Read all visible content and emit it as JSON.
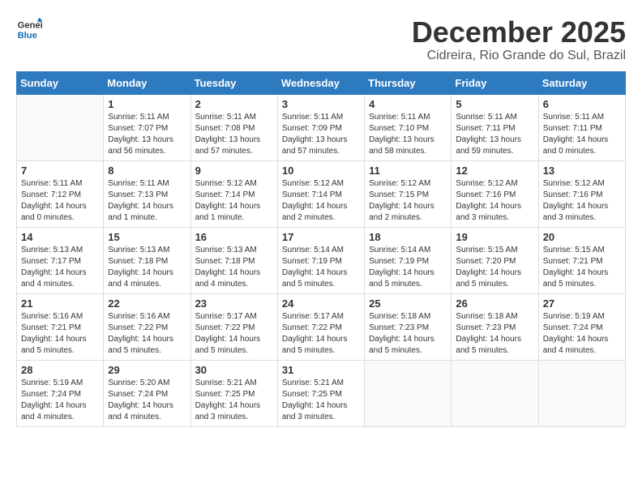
{
  "header": {
    "logo_line1": "General",
    "logo_line2": "Blue",
    "month": "December 2025",
    "location": "Cidreira, Rio Grande do Sul, Brazil"
  },
  "weekdays": [
    "Sunday",
    "Monday",
    "Tuesday",
    "Wednesday",
    "Thursday",
    "Friday",
    "Saturday"
  ],
  "weeks": [
    [
      {
        "day": "",
        "info": ""
      },
      {
        "day": "1",
        "info": "Sunrise: 5:11 AM\nSunset: 7:07 PM\nDaylight: 13 hours\nand 56 minutes."
      },
      {
        "day": "2",
        "info": "Sunrise: 5:11 AM\nSunset: 7:08 PM\nDaylight: 13 hours\nand 57 minutes."
      },
      {
        "day": "3",
        "info": "Sunrise: 5:11 AM\nSunset: 7:09 PM\nDaylight: 13 hours\nand 57 minutes."
      },
      {
        "day": "4",
        "info": "Sunrise: 5:11 AM\nSunset: 7:10 PM\nDaylight: 13 hours\nand 58 minutes."
      },
      {
        "day": "5",
        "info": "Sunrise: 5:11 AM\nSunset: 7:11 PM\nDaylight: 13 hours\nand 59 minutes."
      },
      {
        "day": "6",
        "info": "Sunrise: 5:11 AM\nSunset: 7:11 PM\nDaylight: 14 hours\nand 0 minutes."
      }
    ],
    [
      {
        "day": "7",
        "info": "Sunrise: 5:11 AM\nSunset: 7:12 PM\nDaylight: 14 hours\nand 0 minutes."
      },
      {
        "day": "8",
        "info": "Sunrise: 5:11 AM\nSunset: 7:13 PM\nDaylight: 14 hours\nand 1 minute."
      },
      {
        "day": "9",
        "info": "Sunrise: 5:12 AM\nSunset: 7:14 PM\nDaylight: 14 hours\nand 1 minute."
      },
      {
        "day": "10",
        "info": "Sunrise: 5:12 AM\nSunset: 7:14 PM\nDaylight: 14 hours\nand 2 minutes."
      },
      {
        "day": "11",
        "info": "Sunrise: 5:12 AM\nSunset: 7:15 PM\nDaylight: 14 hours\nand 2 minutes."
      },
      {
        "day": "12",
        "info": "Sunrise: 5:12 AM\nSunset: 7:16 PM\nDaylight: 14 hours\nand 3 minutes."
      },
      {
        "day": "13",
        "info": "Sunrise: 5:12 AM\nSunset: 7:16 PM\nDaylight: 14 hours\nand 3 minutes."
      }
    ],
    [
      {
        "day": "14",
        "info": "Sunrise: 5:13 AM\nSunset: 7:17 PM\nDaylight: 14 hours\nand 4 minutes."
      },
      {
        "day": "15",
        "info": "Sunrise: 5:13 AM\nSunset: 7:18 PM\nDaylight: 14 hours\nand 4 minutes."
      },
      {
        "day": "16",
        "info": "Sunrise: 5:13 AM\nSunset: 7:18 PM\nDaylight: 14 hours\nand 4 minutes."
      },
      {
        "day": "17",
        "info": "Sunrise: 5:14 AM\nSunset: 7:19 PM\nDaylight: 14 hours\nand 5 minutes."
      },
      {
        "day": "18",
        "info": "Sunrise: 5:14 AM\nSunset: 7:19 PM\nDaylight: 14 hours\nand 5 minutes."
      },
      {
        "day": "19",
        "info": "Sunrise: 5:15 AM\nSunset: 7:20 PM\nDaylight: 14 hours\nand 5 minutes."
      },
      {
        "day": "20",
        "info": "Sunrise: 5:15 AM\nSunset: 7:21 PM\nDaylight: 14 hours\nand 5 minutes."
      }
    ],
    [
      {
        "day": "21",
        "info": "Sunrise: 5:16 AM\nSunset: 7:21 PM\nDaylight: 14 hours\nand 5 minutes."
      },
      {
        "day": "22",
        "info": "Sunrise: 5:16 AM\nSunset: 7:22 PM\nDaylight: 14 hours\nand 5 minutes."
      },
      {
        "day": "23",
        "info": "Sunrise: 5:17 AM\nSunset: 7:22 PM\nDaylight: 14 hours\nand 5 minutes."
      },
      {
        "day": "24",
        "info": "Sunrise: 5:17 AM\nSunset: 7:22 PM\nDaylight: 14 hours\nand 5 minutes."
      },
      {
        "day": "25",
        "info": "Sunrise: 5:18 AM\nSunset: 7:23 PM\nDaylight: 14 hours\nand 5 minutes."
      },
      {
        "day": "26",
        "info": "Sunrise: 5:18 AM\nSunset: 7:23 PM\nDaylight: 14 hours\nand 5 minutes."
      },
      {
        "day": "27",
        "info": "Sunrise: 5:19 AM\nSunset: 7:24 PM\nDaylight: 14 hours\nand 4 minutes."
      }
    ],
    [
      {
        "day": "28",
        "info": "Sunrise: 5:19 AM\nSunset: 7:24 PM\nDaylight: 14 hours\nand 4 minutes."
      },
      {
        "day": "29",
        "info": "Sunrise: 5:20 AM\nSunset: 7:24 PM\nDaylight: 14 hours\nand 4 minutes."
      },
      {
        "day": "30",
        "info": "Sunrise: 5:21 AM\nSunset: 7:25 PM\nDaylight: 14 hours\nand 3 minutes."
      },
      {
        "day": "31",
        "info": "Sunrise: 5:21 AM\nSunset: 7:25 PM\nDaylight: 14 hours\nand 3 minutes."
      },
      {
        "day": "",
        "info": ""
      },
      {
        "day": "",
        "info": ""
      },
      {
        "day": "",
        "info": ""
      }
    ]
  ]
}
